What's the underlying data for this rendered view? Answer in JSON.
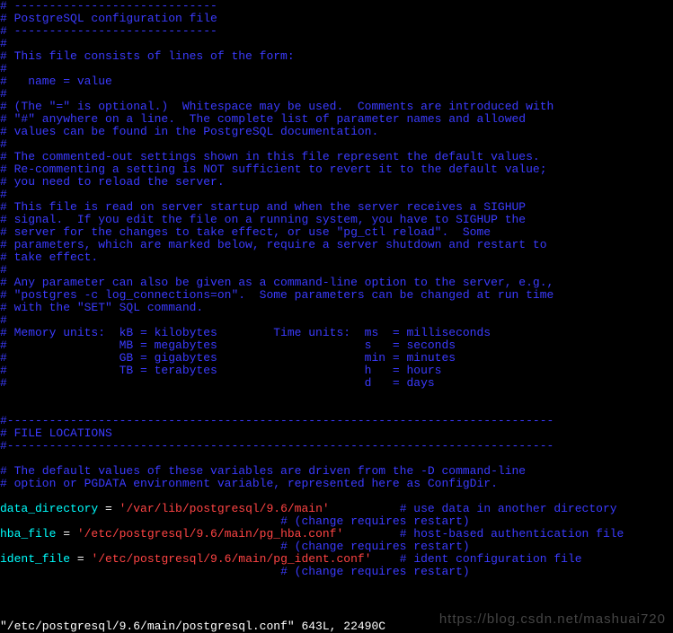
{
  "lines": [
    {
      "segs": [
        {
          "cls": "c",
          "t": "# -----------------------------"
        }
      ]
    },
    {
      "segs": [
        {
          "cls": "c",
          "t": "# PostgreSQL configuration file"
        }
      ]
    },
    {
      "segs": [
        {
          "cls": "c",
          "t": "# -----------------------------"
        }
      ]
    },
    {
      "segs": [
        {
          "cls": "c",
          "t": "#"
        }
      ]
    },
    {
      "segs": [
        {
          "cls": "c",
          "t": "# This file consists of lines of the form:"
        }
      ]
    },
    {
      "segs": [
        {
          "cls": "c",
          "t": "#"
        }
      ]
    },
    {
      "segs": [
        {
          "cls": "c",
          "t": "#   name = value"
        }
      ]
    },
    {
      "segs": [
        {
          "cls": "c",
          "t": "#"
        }
      ]
    },
    {
      "segs": [
        {
          "cls": "c",
          "t": "# (The \"=\" is optional.)  Whitespace may be used.  Comments are introduced with"
        }
      ]
    },
    {
      "segs": [
        {
          "cls": "c",
          "t": "# \"#\" anywhere on a line.  The complete list of parameter names and allowed"
        }
      ]
    },
    {
      "segs": [
        {
          "cls": "c",
          "t": "# values can be found in the PostgreSQL documentation."
        }
      ]
    },
    {
      "segs": [
        {
          "cls": "c",
          "t": "#"
        }
      ]
    },
    {
      "segs": [
        {
          "cls": "c",
          "t": "# The commented-out settings shown in this file represent the default values."
        }
      ]
    },
    {
      "segs": [
        {
          "cls": "c",
          "t": "# Re-commenting a setting is NOT sufficient to revert it to the default value;"
        }
      ]
    },
    {
      "segs": [
        {
          "cls": "c",
          "t": "# you need to reload the server."
        }
      ]
    },
    {
      "segs": [
        {
          "cls": "c",
          "t": "#"
        }
      ]
    },
    {
      "segs": [
        {
          "cls": "c",
          "t": "# This file is read on server startup and when the server receives a SIGHUP"
        }
      ]
    },
    {
      "segs": [
        {
          "cls": "c",
          "t": "# signal.  If you edit the file on a running system, you have to SIGHUP the"
        }
      ]
    },
    {
      "segs": [
        {
          "cls": "c",
          "t": "# server for the changes to take effect, or use \"pg_ctl reload\".  Some"
        }
      ]
    },
    {
      "segs": [
        {
          "cls": "c",
          "t": "# parameters, which are marked below, require a server shutdown and restart to"
        }
      ]
    },
    {
      "segs": [
        {
          "cls": "c",
          "t": "# take effect."
        }
      ]
    },
    {
      "segs": [
        {
          "cls": "c",
          "t": "#"
        }
      ]
    },
    {
      "segs": [
        {
          "cls": "c",
          "t": "# Any parameter can also be given as a command-line option to the server, e.g.,"
        }
      ]
    },
    {
      "segs": [
        {
          "cls": "c",
          "t": "# \"postgres -c log_connections=on\".  Some parameters can be changed at run time"
        }
      ]
    },
    {
      "segs": [
        {
          "cls": "c",
          "t": "# with the \"SET\" SQL command."
        }
      ]
    },
    {
      "segs": [
        {
          "cls": "c",
          "t": "#"
        }
      ]
    },
    {
      "segs": [
        {
          "cls": "c",
          "t": "# Memory units:  kB = kilobytes        Time units:  ms  = milliseconds"
        }
      ]
    },
    {
      "segs": [
        {
          "cls": "c",
          "t": "#                MB = megabytes                     s   = seconds"
        }
      ]
    },
    {
      "segs": [
        {
          "cls": "c",
          "t": "#                GB = gigabytes                     min = minutes"
        }
      ]
    },
    {
      "segs": [
        {
          "cls": "c",
          "t": "#                TB = terabytes                     h   = hours"
        }
      ]
    },
    {
      "segs": [
        {
          "cls": "c",
          "t": "#                                                   d   = days"
        }
      ]
    },
    {
      "segs": [
        {
          "cls": "c",
          "t": ""
        }
      ]
    },
    {
      "segs": [
        {
          "cls": "c",
          "t": ""
        }
      ]
    },
    {
      "segs": [
        {
          "cls": "c",
          "t": "#------------------------------------------------------------------------------"
        }
      ]
    },
    {
      "segs": [
        {
          "cls": "c",
          "t": "# FILE LOCATIONS"
        }
      ]
    },
    {
      "segs": [
        {
          "cls": "c",
          "t": "#------------------------------------------------------------------------------"
        }
      ]
    },
    {
      "segs": [
        {
          "cls": "c",
          "t": ""
        }
      ]
    },
    {
      "segs": [
        {
          "cls": "c",
          "t": "# The default values of these variables are driven from the -D command-line"
        }
      ]
    },
    {
      "segs": [
        {
          "cls": "c",
          "t": "# option or PGDATA environment variable, represented here as ConfigDir."
        }
      ]
    },
    {
      "segs": [
        {
          "cls": "c",
          "t": ""
        }
      ]
    },
    {
      "segs": [
        {
          "cls": "k",
          "t": "data_directory "
        },
        {
          "cls": "w",
          "t": "= "
        },
        {
          "cls": "s",
          "t": "'/var/lib/postgresql/9.6/main'"
        },
        {
          "cls": "w",
          "t": "          "
        },
        {
          "cls": "c",
          "t": "# use data in another directory"
        }
      ]
    },
    {
      "segs": [
        {
          "cls": "w",
          "t": "                                        "
        },
        {
          "cls": "c",
          "t": "# (change requires restart)"
        }
      ]
    },
    {
      "segs": [
        {
          "cls": "k",
          "t": "hba_file "
        },
        {
          "cls": "w",
          "t": "= "
        },
        {
          "cls": "s",
          "t": "'/etc/postgresql/9.6/main/pg_hba.conf'"
        },
        {
          "cls": "w",
          "t": "        "
        },
        {
          "cls": "c",
          "t": "# host-based authentication file"
        }
      ]
    },
    {
      "segs": [
        {
          "cls": "w",
          "t": "                                        "
        },
        {
          "cls": "c",
          "t": "# (change requires restart)"
        }
      ]
    },
    {
      "segs": [
        {
          "cls": "k",
          "t": "ident_file "
        },
        {
          "cls": "w",
          "t": "= "
        },
        {
          "cls": "s",
          "t": "'/etc/postgresql/9.6/main/pg_ident.conf'"
        },
        {
          "cls": "w",
          "t": "    "
        },
        {
          "cls": "c",
          "t": "# ident configuration file"
        }
      ]
    },
    {
      "segs": [
        {
          "cls": "w",
          "t": "                                        "
        },
        {
          "cls": "c",
          "t": "# (change requires restart)"
        }
      ]
    }
  ],
  "status_line": "\"/etc/postgresql/9.6/main/postgresql.conf\" 643L, 22490C",
  "watermark": "https://blog.csdn.net/mashuai720"
}
